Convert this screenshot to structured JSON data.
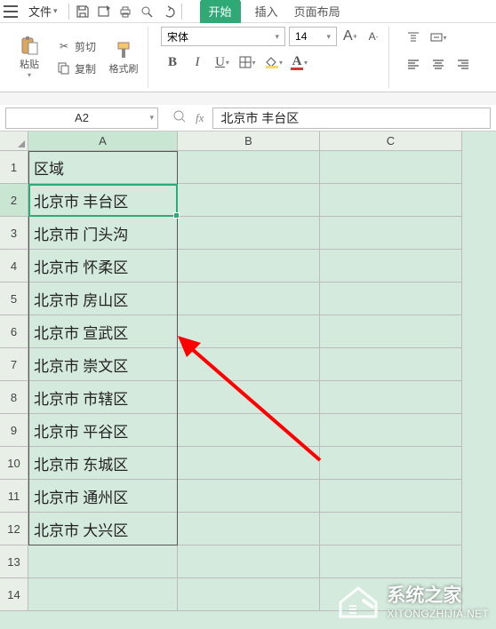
{
  "menu": {
    "file_label": "文件",
    "tabs": {
      "start": "开始",
      "insert": "插入",
      "pagelayout": "页面布局"
    }
  },
  "ribbon": {
    "paste_label": "粘贴",
    "cut_label": "剪切",
    "copy_label": "复制",
    "format_painter_label": "格式刷",
    "font_name": "宋体",
    "font_size": "14",
    "bold": "B",
    "italic": "I",
    "underline": "U",
    "increase_font": "A",
    "decrease_font": "A"
  },
  "refbar": {
    "cell": "A2",
    "formula": "北京市  丰台区",
    "fx": "fx"
  },
  "sheet": {
    "columns": [
      "A",
      "B",
      "C"
    ],
    "rows": [
      "1",
      "2",
      "3",
      "4",
      "5",
      "6",
      "7",
      "8",
      "9",
      "10",
      "11",
      "12",
      "13",
      "14"
    ],
    "colA": [
      "区域",
      "北京市  丰台区",
      "北京市  门头沟",
      "北京市  怀柔区",
      "北京市  房山区",
      "北京市  宣武区",
      "北京市  崇文区",
      "北京市  市辖区",
      "北京市  平谷区",
      "北京市  东城区",
      "北京市  通州区",
      "北京市  大兴区",
      "",
      ""
    ]
  },
  "watermark": {
    "title": "系统之家",
    "url": "XITONGZHIJIA.NET"
  },
  "colors": {
    "accent": "#2fa976",
    "sheet_bg": "#d4eadc",
    "arrow": "#ff0000"
  },
  "chart_data": null
}
